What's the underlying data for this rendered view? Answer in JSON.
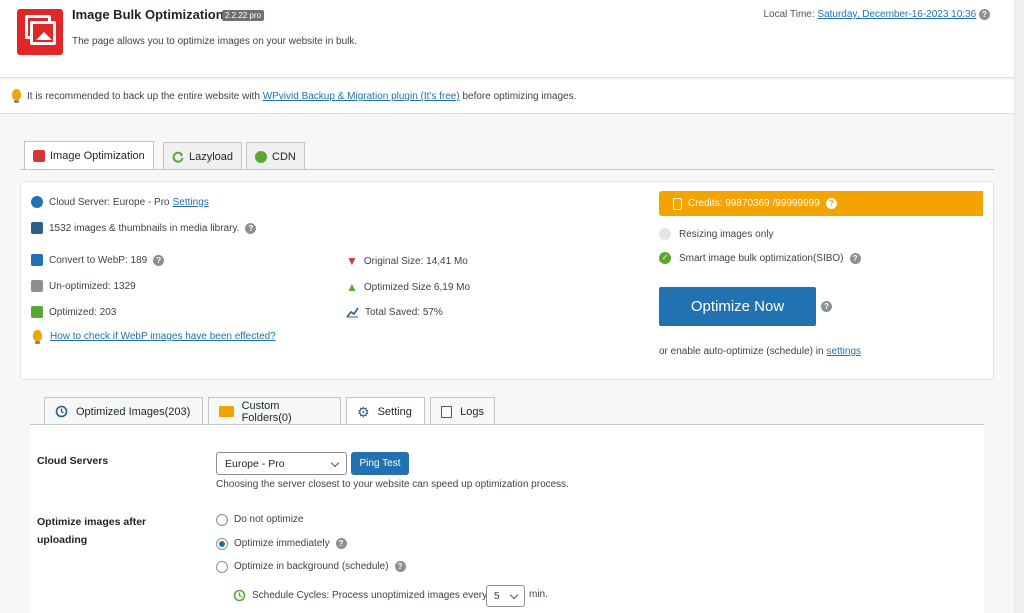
{
  "header": {
    "title": "Image Bulk Optimization",
    "version": "2.2.22 pro",
    "subtitle": "The page allows you to optimize images on your website in bulk.",
    "local_time_label": "Local Time:",
    "local_time_value": "Saturday, December-16-2023 10:36"
  },
  "notice": {
    "prefix": "It is recommended to back up the entire website with",
    "link": "WPvivid Backup & Migration plugin (It's free)",
    "suffix": "before optimizing images."
  },
  "tabs": [
    {
      "label": "Image Optimization",
      "icon": "image-icon"
    },
    {
      "label": "Lazyload",
      "icon": "refresh-icon"
    },
    {
      "label": "CDN",
      "icon": "globe-icon"
    }
  ],
  "overview": {
    "cloud_server_text": "Cloud Server: Europe - Pro",
    "settings_link": "Settings",
    "library_count": "1532 images & thumbnails in media library.",
    "convert_webp": "Convert to WebP: 189",
    "unoptimized": "Un-optimized: 1329",
    "optimized": "Optimized: 203",
    "webp_help_link": "How to check if WebP images have been effected?",
    "original_size": "Original Size: 14,41 Mo",
    "optimized_size": "Optimized Size 6,19 Mo",
    "total_saved": "Total Saved: 57%"
  },
  "credits": {
    "text": "Credits: 99870369 /99999999"
  },
  "modes": [
    {
      "label": "Resizing images only",
      "active": false
    },
    {
      "label": "Smart image bulk optimization(SIBO)",
      "active": true
    }
  ],
  "optimize_button": "Optimize Now",
  "auto_text": "or enable auto-optimize (schedule) in",
  "auto_link": "settings",
  "subtabs": [
    {
      "label": "Optimized Images(203)",
      "icon": "history-icon"
    },
    {
      "label": "Custom Folders(0)",
      "icon": "folder-icon"
    },
    {
      "label": "Setting",
      "icon": "gear-icon"
    },
    {
      "label": "Logs",
      "icon": "edit-icon"
    }
  ],
  "settings": {
    "cloud_servers_label": "Cloud Servers",
    "server_selected": "Europe - Pro",
    "ping_button": "Ping Test",
    "server_hint": "Choosing the server closest to your website can speed up optimization process.",
    "after_upload_label_1": "Optimize images after",
    "after_upload_label_2": "uploading",
    "options": [
      {
        "label": "Do not optimize",
        "selected": false
      },
      {
        "label": "Optimize immediately",
        "selected": true
      },
      {
        "label": "Optimize in background (schedule)",
        "selected": false
      }
    ],
    "schedule_text": "Schedule Cycles: Process unoptimized images every",
    "schedule_value": "5",
    "schedule_unit": "min."
  },
  "colors": {
    "accent": "#2271b1",
    "credits_bg": "#f4a300",
    "logo_red": "#e02727"
  }
}
